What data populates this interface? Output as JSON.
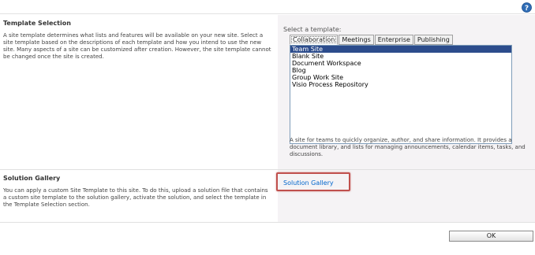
{
  "header": {
    "help_icon": "help-question-icon"
  },
  "template_selection": {
    "title": "Template Selection",
    "description": "A site template determines what lists and features will be available on your new site. Select a site template based on the descriptions of each template and how you intend to use the new site. Many aspects of a site can be customized after creation. However, the site template cannot be changed once the site is created.",
    "select_label": "Select a template:",
    "tabs": [
      {
        "label": "Collaboration",
        "active": true
      },
      {
        "label": "Meetings",
        "active": false
      },
      {
        "label": "Enterprise",
        "active": false
      },
      {
        "label": "Publishing",
        "active": false
      }
    ],
    "templates": [
      {
        "label": "Team Site",
        "selected": true
      },
      {
        "label": "Blank Site",
        "selected": false
      },
      {
        "label": "Document Workspace",
        "selected": false
      },
      {
        "label": "Blog",
        "selected": false
      },
      {
        "label": "Group Work Site",
        "selected": false
      },
      {
        "label": "Visio Process Repository",
        "selected": false
      }
    ],
    "template_description": "A site for teams to quickly organize, author, and share information. It provides a document library, and lists for managing announcements, calendar items, tasks, and discussions."
  },
  "solution_gallery": {
    "title": "Solution Gallery",
    "description": "You can apply a custom Site Template to this site. To do this, upload a solution file that contains a custom site template to the solution gallery, activate the solution, and select the template in the Template Selection section.",
    "link_label": "Solution Gallery"
  },
  "footer": {
    "ok_label": "OK"
  },
  "colors": {
    "selected_bg": "#2c4c8c",
    "right_panel_bg": "#f5f3f5",
    "link": "#0066cc",
    "highlight": "#c0504d",
    "help_icon": "#2f6cb5"
  }
}
